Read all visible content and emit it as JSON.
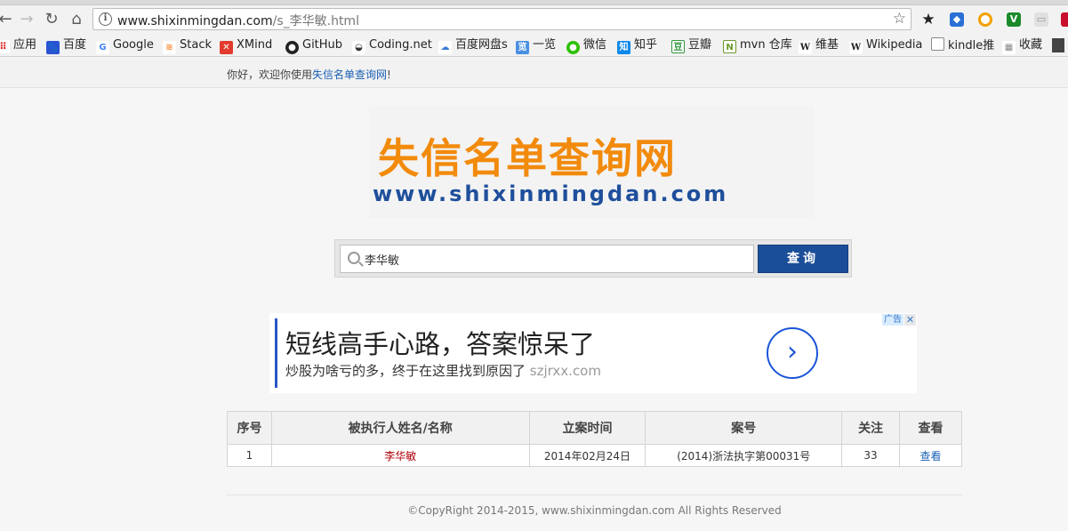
{
  "browser": {
    "url_host": "www.shixinmingdan.com",
    "url_path": "/s_李华敏.html",
    "bookmarks": [
      {
        "label": "应用",
        "icon": "apps-icon"
      },
      {
        "label": "百度",
        "icon": "baidu-icon"
      },
      {
        "label": "Google",
        "icon": "google-icon"
      },
      {
        "label": "Stack",
        "icon": "stackoverflow-icon"
      },
      {
        "label": "XMind",
        "icon": "xmind-icon"
      },
      {
        "label": "GitHub",
        "icon": "github-icon"
      },
      {
        "label": "Coding.net",
        "icon": "coding-icon"
      },
      {
        "label": "百度网盘s",
        "icon": "baidu-pan-icon"
      },
      {
        "label": "一览",
        "icon": "yilan-icon"
      },
      {
        "label": "微信",
        "icon": "wechat-icon"
      },
      {
        "label": "知乎",
        "icon": "zhihu-icon"
      },
      {
        "label": "豆瓣",
        "icon": "douban-icon"
      },
      {
        "label": "mvn 仓库",
        "icon": "mvn-icon"
      },
      {
        "label": "维基",
        "icon": "wiki-icon"
      },
      {
        "label": "Wikipedia",
        "icon": "wikipedia-icon"
      },
      {
        "label": "kindle推",
        "icon": "page-icon"
      },
      {
        "label": "收藏",
        "icon": "folder-icon"
      }
    ]
  },
  "header": {
    "welcome_prefix": "你好，欢迎你使用",
    "welcome_link": "失信名单查询网",
    "welcome_suffix": "!"
  },
  "logo": {
    "title_cn": "失信名单查询网",
    "title_en": "www.shixinmingdan.com"
  },
  "search": {
    "value": "李华敏",
    "button_label": "查询"
  },
  "ad": {
    "title": "短线高手心路，答案惊呆了",
    "description": "炒股为啥亏的多，终于在这里找到原因了",
    "domain": "szjrxx.com",
    "tag": "广告",
    "close": "✕"
  },
  "table": {
    "headers": [
      "序号",
      "被执行人姓名/名称",
      "立案时间",
      "案号",
      "关注",
      "查看"
    ],
    "rows": [
      {
        "index": "1",
        "name": "李华敏",
        "date": "2014年02月24日",
        "case_no": "(2014)浙法执字第00031号",
        "follow": "33",
        "view": "查看"
      }
    ]
  },
  "footer": {
    "text": "©CopyRight 2014-2015, www.shixinmingdan.com All Rights Reserved"
  },
  "colors": {
    "logo_orange": "#f28a0c",
    "logo_blue": "#1e4f9c",
    "button_blue": "#1b4e98",
    "name_red": "#b0000b"
  }
}
